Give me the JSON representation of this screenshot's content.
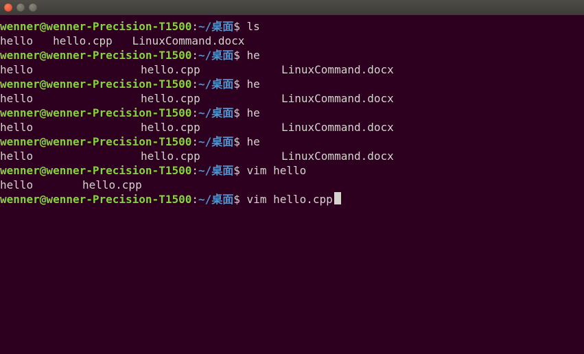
{
  "prompt": {
    "user_host": "wenner@wenner-Precision-T1500",
    "sep": ":",
    "path": "~/桌面",
    "sigil": "$"
  },
  "history": [
    {
      "cmd": "ls",
      "output_kind": "ls1"
    },
    {
      "cmd": "he",
      "output_kind": "cols3"
    },
    {
      "cmd": "he",
      "output_kind": "cols3"
    },
    {
      "cmd": "he",
      "output_kind": "cols3"
    },
    {
      "cmd": "he",
      "output_kind": "cols3"
    },
    {
      "cmd": "vim hello",
      "output_kind": "cols2"
    }
  ],
  "current_cmd": "vim hello.cpp",
  "ls1_files": [
    "hello",
    "hello.cpp",
    "LinuxCommand.docx"
  ],
  "cols3_files": [
    "hello",
    "hello.cpp",
    "LinuxCommand.docx"
  ],
  "cols2_files": [
    "hello",
    "hello.cpp"
  ],
  "ls1_joined": "hello   hello.cpp   LinuxCommand.docx"
}
